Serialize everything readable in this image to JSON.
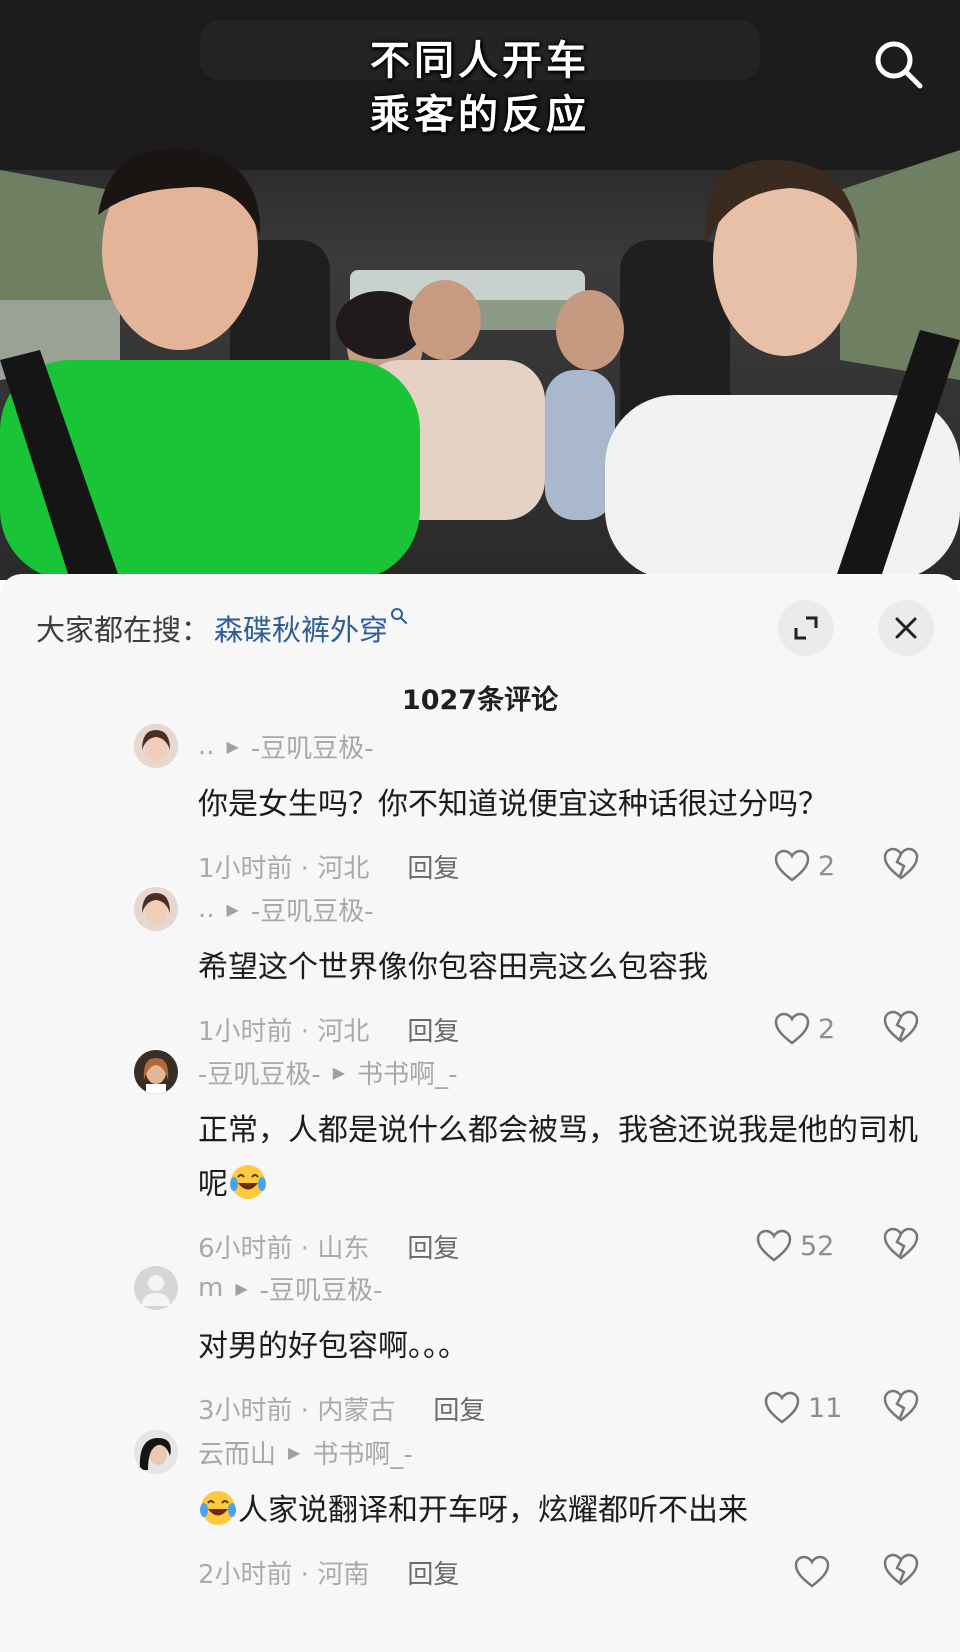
{
  "video": {
    "caption_line1": "不同人开车",
    "caption_line2": "乘客的反应",
    "search_icon": "search-icon"
  },
  "trending": {
    "label": "大家都在搜：",
    "term": "森碟秋裤外穿",
    "term_icon": "search-small-icon"
  },
  "header": {
    "comment_count": "1027条评论",
    "expand_icon": "expand-icon",
    "close_icon": "close-icon"
  },
  "comments": [
    {
      "user": "..",
      "reply_to": "-豆叽豆极-",
      "text": "你是女生吗？你不知道说便宜这种话很过分吗？",
      "time_location": "1小时前 · 河北",
      "reply_label": "回复",
      "likes": "2"
    },
    {
      "user": "..",
      "reply_to": "-豆叽豆极-",
      "text": "希望这个世界像你包容田亮这么包容我",
      "time_location": "1小时前 · 河北",
      "reply_label": "回复",
      "likes": "2"
    },
    {
      "user": "-豆叽豆极-",
      "reply_to": "书书啊_-",
      "text": "正常，人都是说什么都会被骂，我爸还说我是他的司机呢",
      "time_location": "6小时前 · 山东",
      "reply_label": "回复",
      "likes": "52"
    },
    {
      "user": "m",
      "reply_to": "-豆叽豆极-",
      "text": "对男的好包容啊。。。",
      "time_location": "3小时前 · 内蒙古",
      "reply_label": "回复",
      "likes": "11"
    },
    {
      "user": "云而山",
      "reply_to": "书书啊_-",
      "text": "人家说翻译和开车呀，炫耀都听不出来",
      "time_location": "2小时前 · 河南",
      "reply_label": "回复",
      "likes": ""
    }
  ],
  "colors": {
    "link_blue": "#2f5d96",
    "muted_gray": "#aaaaaa",
    "sheet_bg": "#f7f7f7",
    "shirt_green": "#19c437"
  }
}
